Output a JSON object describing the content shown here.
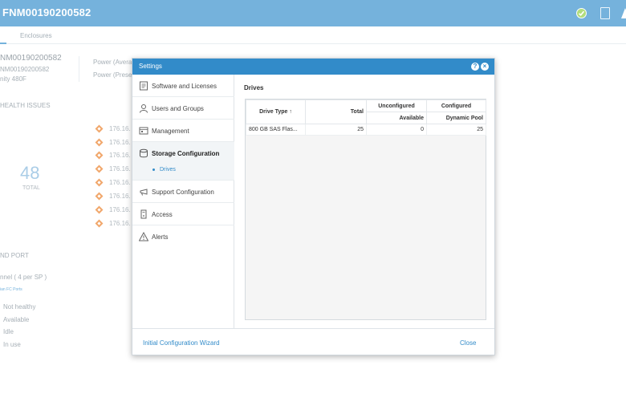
{
  "app": {
    "system_name": "FNM00190200582",
    "tab": "Enclosures",
    "serial_large": "NM00190200582",
    "serial_small": "NM00190200582",
    "model": "nity 480F",
    "power_avg": "Power (Averag",
    "power_present": "Power (Presen",
    "health_header": "HEALTH ISSUES",
    "issues": [
      "176.16.",
      "176.16.",
      "176.16.",
      "176.16.",
      "176.16.",
      "176.16.",
      "176.16.",
      "176.16."
    ],
    "total_count": "48",
    "total_label": "TOTAL",
    "port_header": "ND PORT",
    "channel_text": "nnel ( 4 per SP )",
    "channel_link": "ian FC Ports",
    "legend": [
      "Not healthy",
      "Available",
      "Idle",
      "In use"
    ]
  },
  "dialog": {
    "title": "Settings",
    "nav": [
      {
        "label": "Software and Licenses",
        "icon": "license-icon"
      },
      {
        "label": "Users and Groups",
        "icon": "user-icon"
      },
      {
        "label": "Management",
        "icon": "management-icon"
      },
      {
        "label": "Storage Configuration",
        "icon": "storage-icon"
      },
      {
        "label": "Support Configuration",
        "icon": "support-icon"
      },
      {
        "label": "Access",
        "icon": "access-icon"
      },
      {
        "label": "Alerts",
        "icon": "alert-icon"
      }
    ],
    "sub_item": "Drives",
    "content_title": "Drives",
    "table": {
      "col_drive_type": "Drive Type",
      "sort_glyph": "↑",
      "col_total": "Total",
      "col_unconfigured": "Unconfigured",
      "col_configured": "Configured",
      "col_available": "Available",
      "col_dynamic_pool": "Dynamic Pool",
      "rows": [
        {
          "drive_type": "800 GB SAS Flas...",
          "total": "25",
          "available": "0",
          "dynamic_pool": "25"
        }
      ]
    },
    "footer": {
      "wizard": "Initial Configuration Wizard",
      "close": "Close"
    }
  },
  "colors": {
    "topbar": "#62a8d8",
    "dialog_header": "#328bc9",
    "link": "#328bc9",
    "warning": "#ef9b57",
    "healthy": "#a7d96b"
  }
}
